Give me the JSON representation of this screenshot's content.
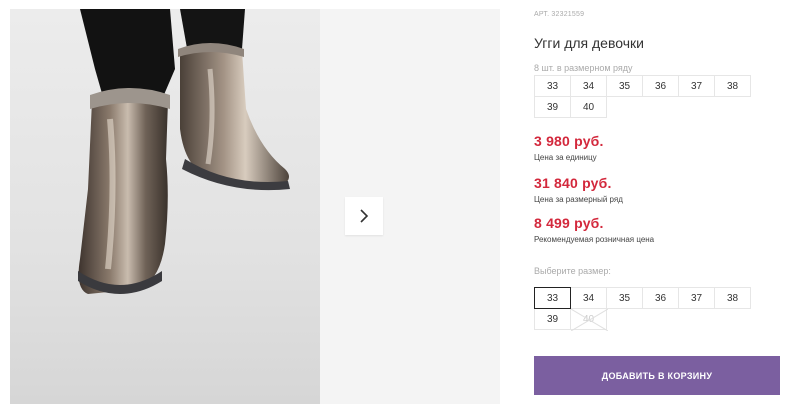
{
  "product": {
    "sku": "АРТ. 32321559",
    "title": "Угги для девочки",
    "image_alt": "boots-photo"
  },
  "size_row": {
    "label": "8 шт. в размерном ряду",
    "sizes": [
      "33",
      "34",
      "35",
      "36",
      "37",
      "38",
      "39",
      "40"
    ]
  },
  "prices": {
    "unit_price": "3 980 руб.",
    "unit_label": "Цена за единицу",
    "row_price": "31 840 руб.",
    "row_label": "Цена за размерный ряд",
    "rrp_price": "8 499 руб.",
    "rrp_label": "Рекомендуемая розничная цена"
  },
  "size_select": {
    "label": "Выберите размер:",
    "sizes": [
      "33",
      "34",
      "35",
      "36",
      "37",
      "38",
      "39",
      "40"
    ],
    "selected": "33",
    "unavailable": [
      "40"
    ]
  },
  "cart": {
    "button_label": "ДОБАВИТЬ В КОРЗИНУ"
  },
  "colors": {
    "price": "#d3283c",
    "button": "#7b5fa0"
  },
  "icons": {
    "next": "chevron-right-icon"
  }
}
